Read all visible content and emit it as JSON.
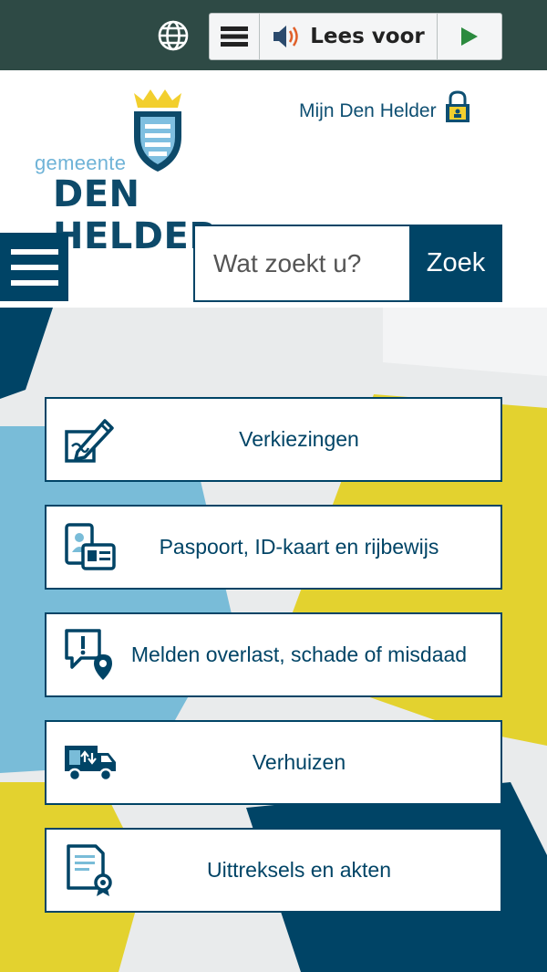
{
  "toolbar": {
    "language_icon": "globe-icon",
    "readspeaker_menu_icon": "menu-lines-icon",
    "read_aloud_label": "Lees voor",
    "read_aloud_icon": "speaker-icon",
    "play_icon": "play-icon"
  },
  "header": {
    "logo_prefix": "gemeente",
    "logo_name": "DEN HELDER",
    "account_link": "Mijn Den Helder",
    "account_icon": "padlock-icon"
  },
  "search": {
    "placeholder": "Wat zoekt u?",
    "button_label": "Zoek"
  },
  "tiles": [
    {
      "label": "Verkiezingen",
      "icon": "pencil-ballot-icon"
    },
    {
      "label": "Paspoort, ID-kaart en rijbewijs",
      "icon": "id-documents-icon"
    },
    {
      "label": "Melden overlast, schade of misdaad",
      "icon": "report-location-icon"
    },
    {
      "label": "Verhuizen",
      "icon": "moving-truck-icon"
    },
    {
      "label": "Uittreksels en akten",
      "icon": "certificate-icon"
    }
  ],
  "colors": {
    "primary": "#004466",
    "topbar": "#2e4a45",
    "light_blue": "#79bcd8",
    "yellow": "#e3d22f",
    "grey": "#e9ebec",
    "play_green": "#2b8a3e"
  }
}
